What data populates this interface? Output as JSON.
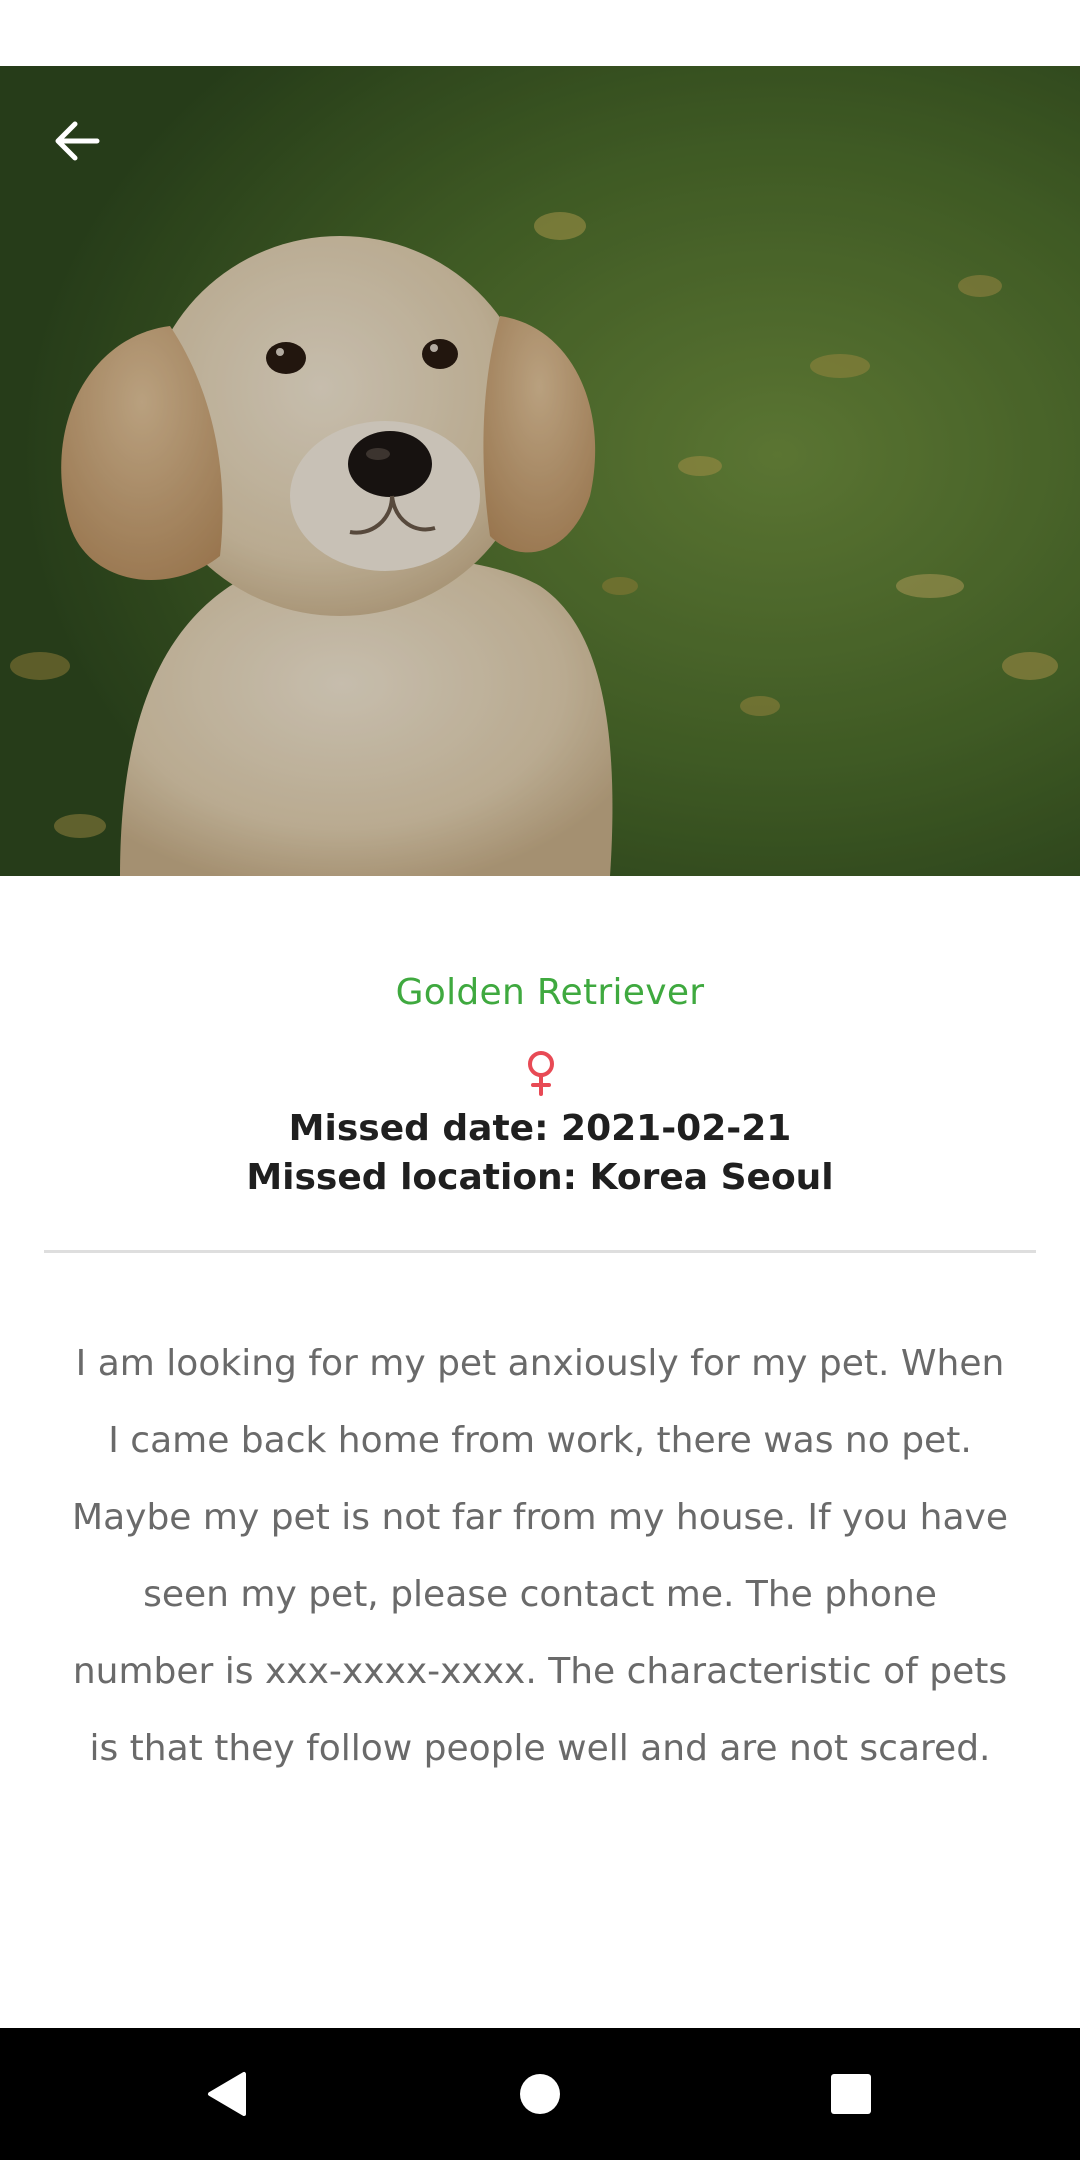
{
  "header": {
    "back_icon": "arrow-left-icon",
    "hero_image": "golden-retriever-puppy-photo"
  },
  "pet": {
    "breed": "Golden Retriever",
    "gender_icon": "female-symbol-icon",
    "missed_date": "Missed date: 2021-02-21",
    "missed_location": "Missed location: Korea Seoul",
    "description": "I am looking for my pet anxiously for my pet. When I came back home from work, there was no pet. Maybe my pet is not far from my house. If you have seen my pet, please contact me. The phone number is xxx-xxxx-xxxx. The characteristic of pets is that they follow people well and are not scared."
  },
  "navigation": {
    "back_icon": "triangle-back-icon",
    "home_icon": "circle-home-icon",
    "recents_icon": "square-recents-icon"
  },
  "colors": {
    "breed_text": "#3fa93f",
    "gender_icon": "#e84a55",
    "heading_text": "#1f1f1f",
    "body_text": "#6a6a6a",
    "divider": "#dedede",
    "nav_bar": "#000000",
    "nav_icon": "#ffffff"
  }
}
